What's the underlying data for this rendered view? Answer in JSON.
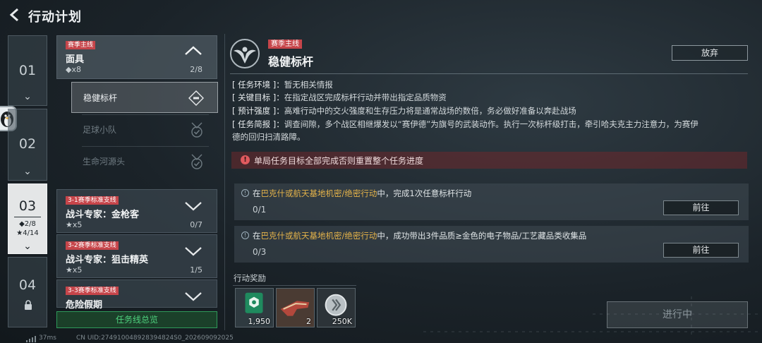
{
  "header": {
    "back_icon": "chevron-left-icon",
    "title": "行动计划"
  },
  "chapters": [
    {
      "num": "01",
      "chevron": "⌄"
    },
    {
      "num": "02",
      "chevron": "⌄"
    },
    {
      "num": "03",
      "stat1": "◆2/8",
      "stat2": "★4/14",
      "chevron": "⌄",
      "active": true
    },
    {
      "num": "04",
      "locked": true
    }
  ],
  "missions": {
    "main": {
      "tag": "赛季主线",
      "title": "面具",
      "stat": "◆x8",
      "progress": "2/8",
      "chevron": "∧"
    },
    "subs": [
      {
        "label": "稳健标杆",
        "state": "active"
      },
      {
        "label": "足球小队",
        "state": "done"
      },
      {
        "label": "生命河源头",
        "state": "done"
      }
    ],
    "branches": [
      {
        "tag": "3-1赛季标准支线",
        "title": "战斗专家：金枪客",
        "stat": "★x5",
        "progress": "0/7"
      },
      {
        "tag": "3-2赛季标准支线",
        "title": "战斗专家：狙击精英",
        "stat": "★x5",
        "progress": "1/5"
      },
      {
        "tag": "3-3赛季标准支线",
        "title": "危险假期",
        "stat": "",
        "progress": ""
      }
    ],
    "overview_label": "任务线总览"
  },
  "detail": {
    "tag": "赛季主线",
    "title": "稳健标杆",
    "abandon_label": "放弃",
    "env_key": "[ 任务环境 ]：",
    "env_val": "暂无相关情报",
    "goal_key": "[ 关键目标 ]：",
    "goal_val": "在指定战区完成标杆行动并带出指定品质物资",
    "intensity_key": "[ 预计强度 ]：",
    "intensity_val": "高难行动中的交火强度和生存压力将是通常战场的数倍，务必做好准备以奔赴战场",
    "brief_key": "[ 任务简报 ]：",
    "brief_val1": "调查间隙，多个战区相继爆发以“赛伊德”为旗号的武装动作。执行一次标杆级打击，牵引哈夫克主力注意力，为赛伊",
    "brief_val2": "德的回归扫清路障。",
    "warning": "单局任务目标全部完成否则重置整个任务进度",
    "tasks": [
      {
        "prefix": "在",
        "highlight": "巴克什或航天基地机密/绝密行动",
        "suffix": "中，完成1次任意标杆行动",
        "progress": "0/1",
        "go_label": "前往"
      },
      {
        "prefix": "在",
        "highlight": "巴克什或航天基地机密/绝密行动",
        "suffix": "中，成功带出3件品质≥金色的电子物品/工艺藏品类收集品",
        "progress": "0/3",
        "go_label": "前往"
      }
    ],
    "rewards_label": "行动奖励",
    "rewards": [
      {
        "icon": "green-badge-icon",
        "qty": "1,950"
      },
      {
        "icon": "weapon-skin-icon",
        "qty": "2"
      },
      {
        "icon": "silver-coin-icon",
        "qty": "250K"
      }
    ],
    "status_button": "进行中"
  },
  "footer": {
    "ping": "37ms",
    "uid": "CN UID:274910048928394824S0_202609092025"
  },
  "colors": {
    "tag_red": "#c6454a",
    "highlight": "#e3b24a",
    "overview_green": "#4fd17e"
  }
}
